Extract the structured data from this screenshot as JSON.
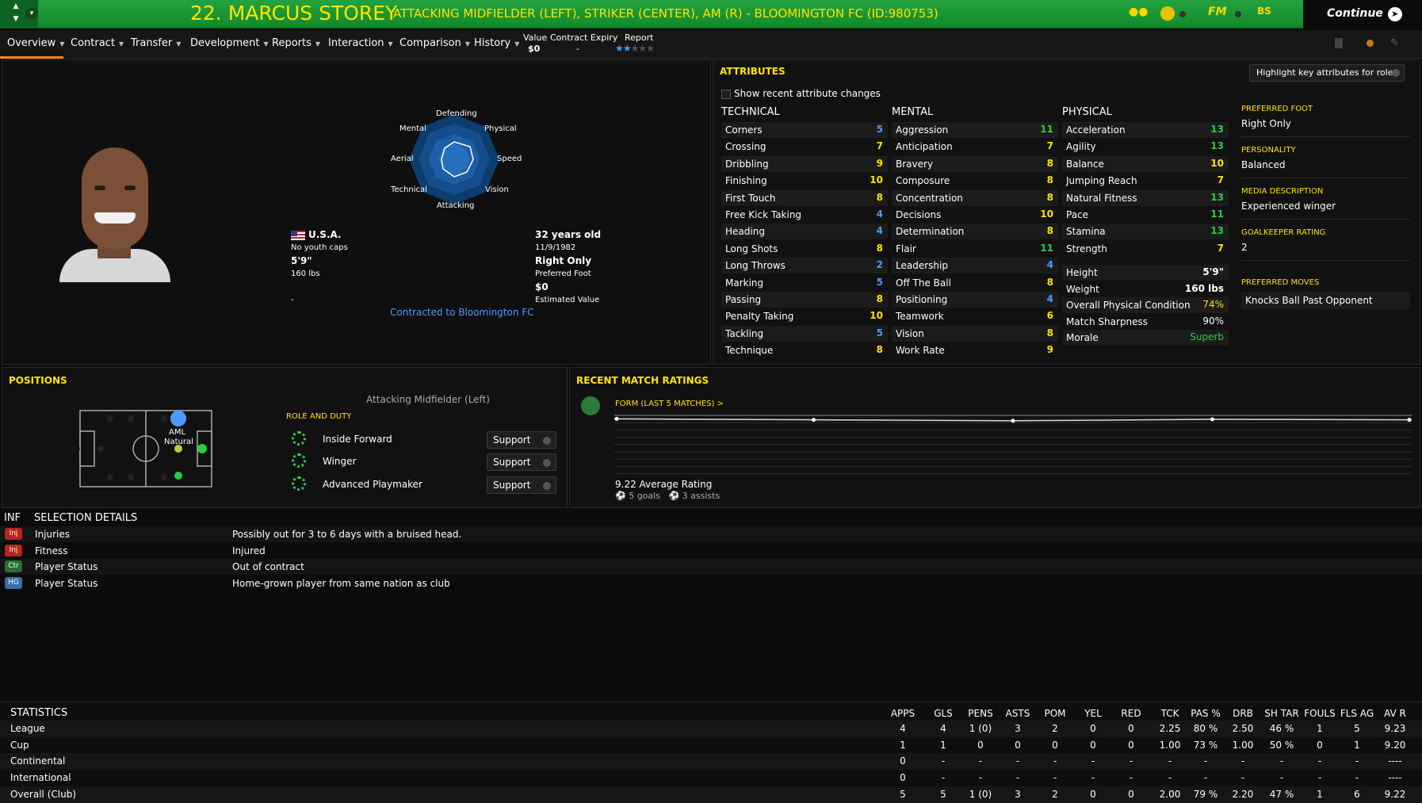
{
  "header": {
    "title": "22. MARCUS STOREY",
    "subtitle": "ATTACKING MIDFIELDER (LEFT), STRIKER (CENTER), AM (R) - BLOOMINGTON FC (ID:980753)",
    "icons": [
      "binoculars-icon",
      "club-badge-icon",
      "fm-logo-icon",
      "bs-icon"
    ],
    "fm_label": "FM",
    "bs_label": "BS",
    "continue_label": "Continue",
    "accent": "#ffe400",
    "bar_color": "#1c9a38"
  },
  "tabs": [
    {
      "label": "Overview"
    },
    {
      "label": "Contract"
    },
    {
      "label": "Transfer"
    },
    {
      "label": "Development"
    },
    {
      "label": "Reports"
    },
    {
      "label": "Interaction"
    },
    {
      "label": "Comparison"
    },
    {
      "label": "History"
    }
  ],
  "quick_info": {
    "value_label": "Value",
    "value": "$0",
    "expiry_label": "Contract Expiry",
    "expiry": "-",
    "report_label": "Report",
    "report_stars": 2,
    "report_stars_max": 5
  },
  "profile": {
    "radar_labels": [
      "Defending",
      "Physical",
      "Speed",
      "Vision",
      "Attacking",
      "Technical",
      "Aerial",
      "Mental"
    ],
    "nationality": "U.S.A.",
    "youth_caps": "No youth caps",
    "height": "5'9\"",
    "weight": "160 lbs",
    "dash": "-",
    "age": "32 years old",
    "dob": "11/9/1982",
    "foot": "Right Only",
    "foot_label": "Preferred Foot",
    "estimated_value": "$0",
    "estimated_value_label": "Estimated Value",
    "contract_link": "Contracted to Bloomington FC"
  },
  "attributes": {
    "title": "ATTRIBUTES",
    "highlight_button": "Highlight key attributes for role",
    "show_changes": "Show recent attribute changes",
    "technical_title": "TECHNICAL",
    "mental_title": "MENTAL",
    "physical_title": "PHYSICAL",
    "technical": [
      {
        "name": "Corners",
        "value": "5"
      },
      {
        "name": "Crossing",
        "value": "7"
      },
      {
        "name": "Dribbling",
        "value": "9"
      },
      {
        "name": "Finishing",
        "value": "10"
      },
      {
        "name": "First Touch",
        "value": "8"
      },
      {
        "name": "Free Kick Taking",
        "value": "4"
      },
      {
        "name": "Heading",
        "value": "4"
      },
      {
        "name": "Long Shots",
        "value": "8"
      },
      {
        "name": "Long Throws",
        "value": "2"
      },
      {
        "name": "Marking",
        "value": "5"
      },
      {
        "name": "Passing",
        "value": "8"
      },
      {
        "name": "Penalty Taking",
        "value": "10"
      },
      {
        "name": "Tackling",
        "value": "5"
      },
      {
        "name": "Technique",
        "value": "8"
      }
    ],
    "mental": [
      {
        "name": "Aggression",
        "value": "11"
      },
      {
        "name": "Anticipation",
        "value": "7"
      },
      {
        "name": "Bravery",
        "value": "8"
      },
      {
        "name": "Composure",
        "value": "8"
      },
      {
        "name": "Concentration",
        "value": "8"
      },
      {
        "name": "Decisions",
        "value": "10"
      },
      {
        "name": "Determination",
        "value": "8"
      },
      {
        "name": "Flair",
        "value": "11"
      },
      {
        "name": "Leadership",
        "value": "4"
      },
      {
        "name": "Off The Ball",
        "value": "8"
      },
      {
        "name": "Positioning",
        "value": "4"
      },
      {
        "name": "Teamwork",
        "value": "6"
      },
      {
        "name": "Vision",
        "value": "8"
      },
      {
        "name": "Work Rate",
        "value": "9"
      }
    ],
    "physical": [
      {
        "name": "Acceleration",
        "value": "13"
      },
      {
        "name": "Agility",
        "value": "13"
      },
      {
        "name": "Balance",
        "value": "10"
      },
      {
        "name": "Jumping Reach",
        "value": "7"
      },
      {
        "name": "Natural Fitness",
        "value": "13"
      },
      {
        "name": "Pace",
        "value": "11"
      },
      {
        "name": "Stamina",
        "value": "13"
      },
      {
        "name": "Strength",
        "value": "7"
      }
    ],
    "physical_info": [
      {
        "name": "Height",
        "value": "5'9\""
      },
      {
        "name": "Weight",
        "value": "160 lbs"
      },
      {
        "name": "Overall Physical Condition",
        "value": "74%"
      },
      {
        "name": "Match Sharpness",
        "value": "90%"
      },
      {
        "name": "Morale",
        "value": "Superb"
      }
    ],
    "side": [
      {
        "label": "PREFERRED FOOT",
        "value": "Right Only"
      },
      {
        "label": "PERSONALITY",
        "value": "Balanced"
      },
      {
        "label": "MEDIA DESCRIPTION",
        "value": "Experienced winger"
      },
      {
        "label": "GOALKEEPER RATING",
        "value": "2"
      }
    ],
    "preferred_moves_label": "PREFERRED MOVES",
    "preferred_moves": [
      "Knocks Ball Past Opponent"
    ]
  },
  "positions": {
    "title": "POSITIONS",
    "position_name": "Attacking Midfielder (Left)",
    "pos_code": "AML",
    "pos_level": "Natural",
    "role_duty_label": "ROLE AND DUTY",
    "roles": [
      {
        "name": "Inside Forward",
        "duty": "Support"
      },
      {
        "name": "Winger",
        "duty": "Support"
      },
      {
        "name": "Advanced Playmaker",
        "duty": "Support"
      }
    ]
  },
  "ratings": {
    "title": "RECENT MATCH RATINGS",
    "form_label": "FORM (LAST 5 MATCHES) >",
    "average": "9.22 Average Rating",
    "goals": "5 goals",
    "assists": "3 assists",
    "form_values": [
      9.3,
      9.2,
      9.1,
      9.25,
      9.2
    ]
  },
  "selection": {
    "inf_label": "INF",
    "title": "SELECTION DETAILS",
    "rows": [
      {
        "badge": "Inj",
        "badge_color": "#b5261e",
        "label": "Injuries",
        "value": "Possibly out for 3 to 6 days with a bruised head."
      },
      {
        "badge": "Inj",
        "badge_color": "#b5261e",
        "label": "Fitness",
        "value": "Injured"
      },
      {
        "badge": "Ctr",
        "badge_color": "#2a6e2f",
        "label": "Player Status",
        "value": "Out of contract"
      },
      {
        "badge": "HG",
        "badge_color": "#3a6fa5",
        "label": "Player Status",
        "value": "Home-grown player from same nation as club"
      }
    ]
  },
  "statistics": {
    "title": "STATISTICS",
    "columns": [
      "APPS",
      "GLS",
      "PENS",
      "ASTS",
      "POM",
      "YEL",
      "RED",
      "TCK",
      "PAS %",
      "DRB",
      "SH TAR",
      "FOULS",
      "FLS AG",
      "AV R"
    ],
    "rows": [
      {
        "name": "League",
        "cells": [
          "4",
          "4",
          "1 (0)",
          "3",
          "2",
          "0",
          "0",
          "2.25",
          "80 %",
          "2.50",
          "46 %",
          "1",
          "5",
          "9.23"
        ]
      },
      {
        "name": "Cup",
        "cells": [
          "1",
          "1",
          "0",
          "0",
          "0",
          "0",
          "0",
          "1.00",
          "73 %",
          "1.00",
          "50 %",
          "0",
          "1",
          "9.20"
        ]
      },
      {
        "name": "Continental",
        "cells": [
          "0",
          "-",
          "-",
          "-",
          "-",
          "-",
          "-",
          "-",
          "-",
          "-",
          "-",
          "-",
          "-",
          "----"
        ]
      },
      {
        "name": "International",
        "cells": [
          "0",
          "-",
          "-",
          "-",
          "-",
          "-",
          "-",
          "-",
          "-",
          "-",
          "-",
          "-",
          "-",
          "----"
        ]
      },
      {
        "name": "Overall (Club)",
        "cells": [
          "5",
          "5",
          "1 (0)",
          "3",
          "2",
          "0",
          "0",
          "2.00",
          "79 %",
          "2.20",
          "47 %",
          "1",
          "6",
          "9.22"
        ]
      }
    ]
  }
}
